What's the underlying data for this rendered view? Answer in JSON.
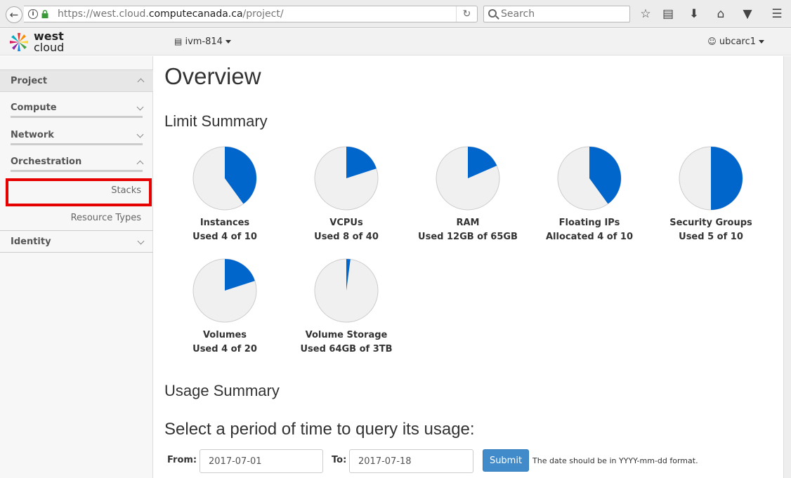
{
  "browser": {
    "url_prefix": "https://west.cloud.",
    "url_domain": "computecanada.ca",
    "url_path": "/project/",
    "search_placeholder": "Search"
  },
  "header": {
    "logo_word1": "west",
    "logo_word2": "cloud",
    "project": "ivm-814",
    "user": "ubcarc1"
  },
  "sidebar": {
    "project": "Project",
    "compute": "Compute",
    "network": "Network",
    "orchestration": "Orchestration",
    "stacks": "Stacks",
    "resource_types": "Resource Types",
    "identity": "Identity"
  },
  "main": {
    "title": "Overview",
    "limit_summary": "Limit Summary",
    "usage_summary": "Usage Summary",
    "period_title": "Select a period of time to query its usage:",
    "from_label": "From:",
    "from_value": "2017-07-01",
    "to_label": "To:",
    "to_value": "2017-07-18",
    "submit": "Submit",
    "hint": "The date should be in YYYY-mm-dd format."
  },
  "colors": {
    "pie_used": "#0066cc",
    "pie_free": "#f0f0f0",
    "pie_border": "#cccccc",
    "highlight": "#e60000"
  },
  "chart_data": {
    "type": "pie",
    "items": [
      {
        "name": "Instances",
        "used_text": "Used 4 of 10",
        "used": 4,
        "total": 10
      },
      {
        "name": "VCPUs",
        "used_text": "Used 8 of 40",
        "used": 8,
        "total": 40
      },
      {
        "name": "RAM",
        "used_text": "Used 12GB of 65GB",
        "used": 12,
        "total": 65
      },
      {
        "name": "Floating IPs",
        "used_text": "Allocated 4 of 10",
        "used": 4,
        "total": 10
      },
      {
        "name": "Security Groups",
        "used_text": "Used 5 of 10",
        "used": 5,
        "total": 10
      },
      {
        "name": "Volumes",
        "used_text": "Used 4 of 20",
        "used": 4,
        "total": 20
      },
      {
        "name": "Volume Storage",
        "used_text": "Used 64GB of 3TB",
        "used": 64,
        "total": 3072
      }
    ]
  }
}
